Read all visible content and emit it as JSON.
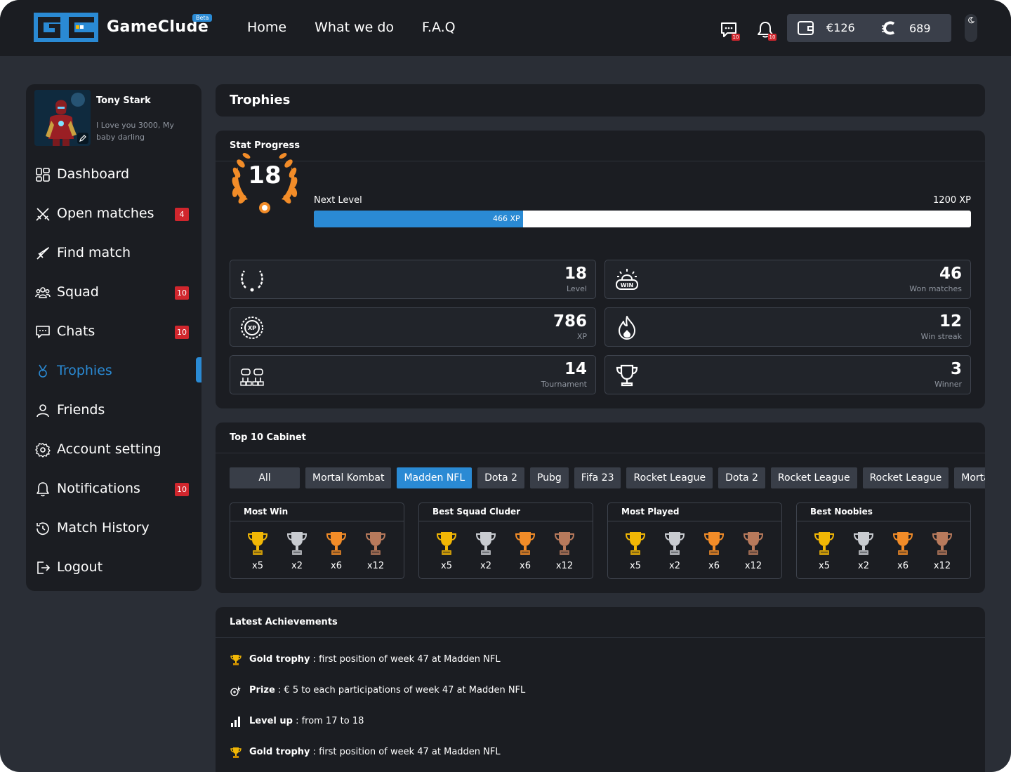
{
  "app": {
    "logo_text": "GameClude",
    "beta_label": "Beta",
    "nav": [
      "Home",
      "What we do",
      "F.A.Q"
    ],
    "chat_badge": "10",
    "notif_badge": "10",
    "wallet_amount": "€126",
    "coin_amount": "689"
  },
  "user": {
    "name": "Tony Stark",
    "bio": "I Love you 3000, My baby darling"
  },
  "sidebar": {
    "items": [
      {
        "label": "Dashboard",
        "badge": ""
      },
      {
        "label": "Open matches",
        "badge": "4"
      },
      {
        "label": "Find match",
        "badge": ""
      },
      {
        "label": "Squad",
        "badge": "10"
      },
      {
        "label": "Chats",
        "badge": "10"
      },
      {
        "label": "Trophies",
        "badge": ""
      },
      {
        "label": "Friends",
        "badge": ""
      },
      {
        "label": "Account setting",
        "badge": ""
      },
      {
        "label": "Notifications",
        "badge": "10"
      },
      {
        "label": "Match History",
        "badge": ""
      },
      {
        "label": "Logout",
        "badge": ""
      }
    ],
    "active": "Trophies"
  },
  "page": {
    "title": "Trophies"
  },
  "stats": {
    "title": "Stat Progress",
    "level": "18",
    "next_level_label": "Next Level",
    "max_xp": "1200 XP",
    "current_xp": "466 XP",
    "progress_fraction": 0.318,
    "cards": [
      {
        "value": "18",
        "label": "Level",
        "icon": "laurel-icon"
      },
      {
        "value": "46",
        "label": "Won matches",
        "icon": "win-siren-icon"
      },
      {
        "value": "786",
        "label": "XP",
        "icon": "xp-badge-icon"
      },
      {
        "value": "12",
        "label": "Win streak",
        "icon": "flame-icon"
      },
      {
        "value": "14",
        "label": "Tournament",
        "icon": "gamepad-bracket-icon"
      },
      {
        "value": "3",
        "label": "Winner",
        "icon": "trophy-icon"
      }
    ]
  },
  "cabinet": {
    "title": "Top 10 Cabinet",
    "tabs": [
      "All",
      "Mortal Kombat",
      "Madden NFL",
      "Dota 2",
      "Pubg",
      "Fifa 23",
      "Rocket League",
      "Dota 2",
      "Rocket League",
      "Rocket League",
      "Mortal Kombat"
    ],
    "active_tab": "Madden NFL",
    "cards": [
      {
        "title": "Most Win",
        "counts": [
          "x5",
          "x2",
          "x6",
          "x12"
        ]
      },
      {
        "title": "Best Squad Cluder",
        "counts": [
          "x5",
          "x2",
          "x6",
          "x12"
        ]
      },
      {
        "title": "Most Played",
        "counts": [
          "x5",
          "x2",
          "x6",
          "x12"
        ]
      },
      {
        "title": "Best Noobies",
        "counts": [
          "x5",
          "x2",
          "x6",
          "x12"
        ]
      }
    ],
    "trophy_colors": [
      "#f2b705",
      "#c9ccd1",
      "#f28c28",
      "#b87a5c"
    ]
  },
  "achievements": {
    "title": "Latest Achievements",
    "items": [
      {
        "icon": "trophy-icon",
        "bold": "Gold trophy",
        "text": " : first position of week 47 at Madden NFL"
      },
      {
        "icon": "prize-icon",
        "bold": "Prize",
        "text": " : € 5 to each participations of week 47 at Madden NFL"
      },
      {
        "icon": "level-bars-icon",
        "bold": "Level up",
        "text": " : from 17 to 18"
      },
      {
        "icon": "trophy-icon",
        "bold": "Gold trophy",
        "text": " : first position of week 47 at Madden NFL"
      }
    ]
  },
  "colors": {
    "accent": "#2a8ad4",
    "badge": "#d0262d",
    "level": "#f28c28"
  }
}
